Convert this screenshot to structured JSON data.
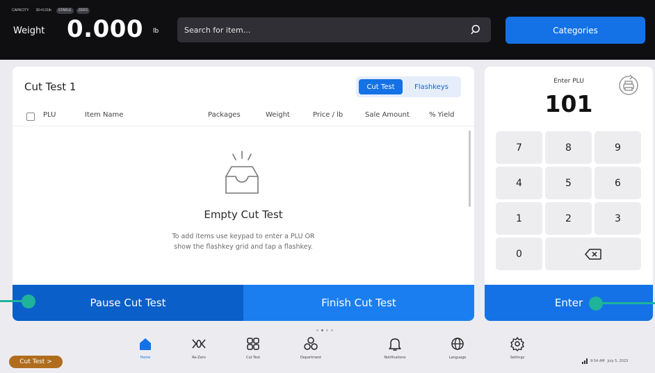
{
  "header": {
    "status_tags": [
      "CAPACITY 30x0.01lb",
      "STABLE",
      "ZERO"
    ],
    "status_prefix": "CAPACITY",
    "status_cap": "30×0.01lb",
    "status_pill1": "STABLE",
    "status_pill2": "ZERO",
    "weight_label": "Weight",
    "weight_value": "0.000",
    "weight_unit": "lb",
    "search_placeholder": "Search for item...",
    "categories_label": "Categories"
  },
  "cut_test": {
    "title": "Cut Test 1",
    "toggle": {
      "active": "Cut Test",
      "inactive": "Flashkeys"
    },
    "columns": [
      "PLU",
      "Item Name",
      "Packages",
      "Weight",
      "Price / lb",
      "Sale Amount",
      "% Yield"
    ],
    "empty_title": "Empty Cut Test",
    "empty_desc": "To add items use keypad to enter a PLU OR show the flashkey grid and tap a flashkey.",
    "pause_label": "Pause Cut Test",
    "finish_label": "Finish Cut Test"
  },
  "keypad": {
    "label": "Enter PLU",
    "value": "101",
    "keys": [
      "7",
      "8",
      "9",
      "4",
      "5",
      "6",
      "1",
      "2",
      "3",
      "0"
    ],
    "enter_label": "Enter"
  },
  "nav": {
    "items": [
      {
        "label": "Home",
        "icon": "home-icon",
        "active": true
      },
      {
        "label": "Re-Zero",
        "icon": "rezero-icon",
        "active": false
      },
      {
        "label": "Cut Test",
        "icon": "grid-icon",
        "active": false
      },
      {
        "label": "Department",
        "icon": "department-icon",
        "active": false
      },
      {
        "label": "Notifications",
        "icon": "bell-icon",
        "active": false
      },
      {
        "label": "Language",
        "icon": "globe-icon",
        "active": false
      },
      {
        "label": "Settings",
        "icon": "gear-icon",
        "active": false
      }
    ],
    "breadcrumb": "Cut Test >",
    "time": "9:54 AM",
    "date": "July 5, 2023"
  },
  "colors": {
    "header_bg": "#0f0f12",
    "accent": "#1472e6",
    "pause_bg": "#0a5fc9",
    "handle": "#1fb39a",
    "chip": "#b06d1e"
  }
}
